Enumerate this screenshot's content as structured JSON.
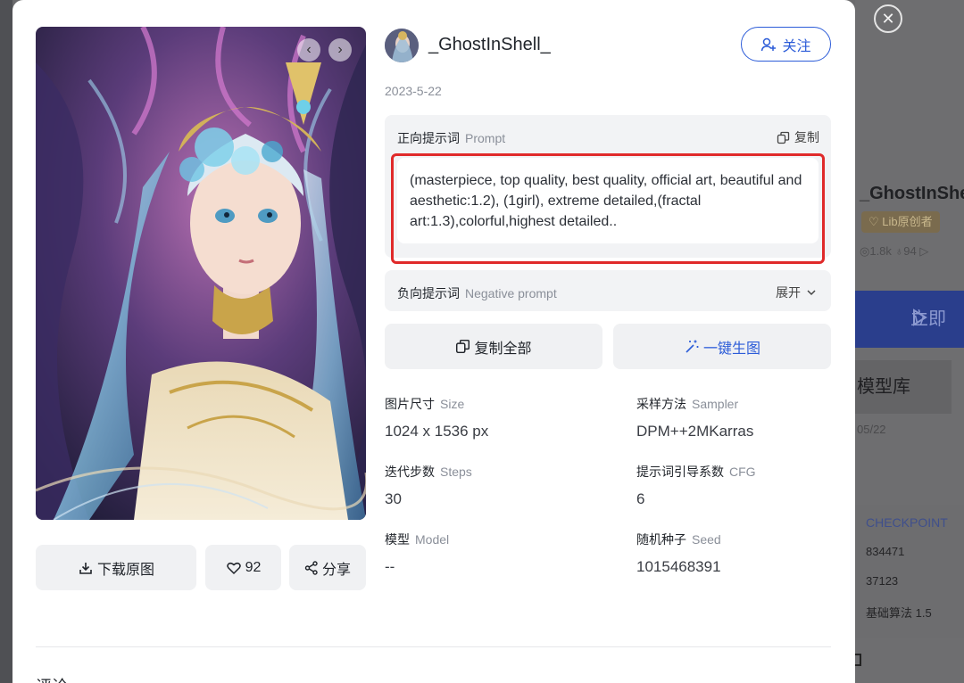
{
  "background": {
    "author": "_GhostInShe",
    "badge": "♡ Lib原创者",
    "stats": "◎1.8k ♁94 ▷",
    "run_label": "立即",
    "library_label": "模型库",
    "date": "05/22",
    "checkpoint_label": "CHECKPOINT",
    "values": [
      "834471",
      "37123",
      "基础算法 1.5"
    ]
  },
  "viewer": {
    "prev_icon": "chevron-left-icon",
    "next_icon": "chevron-right-icon",
    "close_icon": "close-icon"
  },
  "author": {
    "name": "_GhostInShell_",
    "follow_label": "关注",
    "date": "2023-5-22"
  },
  "prompt": {
    "label": "正向提示词",
    "label_en": "Prompt",
    "copy_label": "复制",
    "text": "(masterpiece, top quality, best quality, official art, beautiful and aesthetic:1.2), (1girl), extreme detailed,(fractal art:1.3),colorful,highest detailed.."
  },
  "negative_prompt": {
    "label": "负向提示词",
    "label_en": "Negative prompt",
    "expand_label": "展开"
  },
  "actions": {
    "copy_all_label": "复制全部",
    "generate_label": "一键生图",
    "download_label": "下载原图",
    "like_count": "92",
    "share_label": "分享"
  },
  "params": {
    "size": {
      "label": "图片尺寸",
      "label_en": "Size",
      "value": "1024 x 1536 px"
    },
    "sampler": {
      "label": "采样方法",
      "label_en": "Sampler",
      "value": "DPM++2MKarras"
    },
    "steps": {
      "label": "迭代步数",
      "label_en": "Steps",
      "value": "30"
    },
    "cfg": {
      "label": "提示词引导系数",
      "label_en": "CFG",
      "value": "6"
    },
    "model": {
      "label": "模型",
      "label_en": "Model",
      "value": "--"
    },
    "seed": {
      "label": "随机种子",
      "label_en": "Seed",
      "value": "1015468391"
    }
  },
  "comments": {
    "title": "评论"
  },
  "colors": {
    "accent": "#2c5cd8",
    "highlight": "#e02a2a",
    "panel": "#f2f3f5"
  }
}
